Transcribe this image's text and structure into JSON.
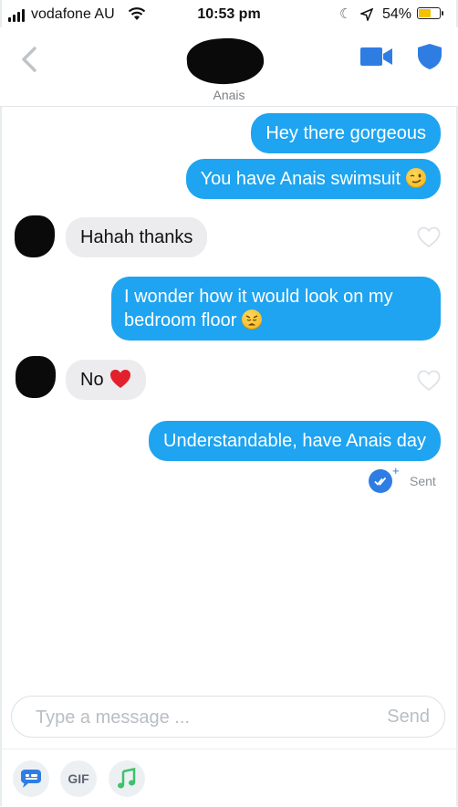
{
  "status_bar": {
    "carrier": "vodafone AU",
    "time": "10:53 pm",
    "battery": "54%",
    "battery_level": 0.54
  },
  "header": {
    "name": "Anais",
    "icons": [
      "back-icon",
      "video-call-icon",
      "shield-icon"
    ]
  },
  "messages": [
    {
      "direction": "out",
      "text": "Hey there gorgeous"
    },
    {
      "direction": "out",
      "text": "You have Anais swimsuit",
      "emoji": "winking-face"
    },
    {
      "direction": "in",
      "text": "Hahah thanks"
    },
    {
      "direction": "out",
      "text": "I wonder how it would look on my bedroom floor",
      "emoji": "weary-face"
    },
    {
      "direction": "in",
      "text": "No",
      "emoji": "red-heart"
    },
    {
      "direction": "out",
      "text": "Understandable, have Anais day"
    }
  ],
  "delivery_status": "Sent",
  "composer": {
    "placeholder": "Type a message ...",
    "send_label": "Send"
  },
  "toolbar": {
    "gif_label": "GIF"
  },
  "colors": {
    "outgoing_bubble": "#1ea4f0",
    "incoming_bubble": "#ececee",
    "accent": "#2f7de3"
  }
}
